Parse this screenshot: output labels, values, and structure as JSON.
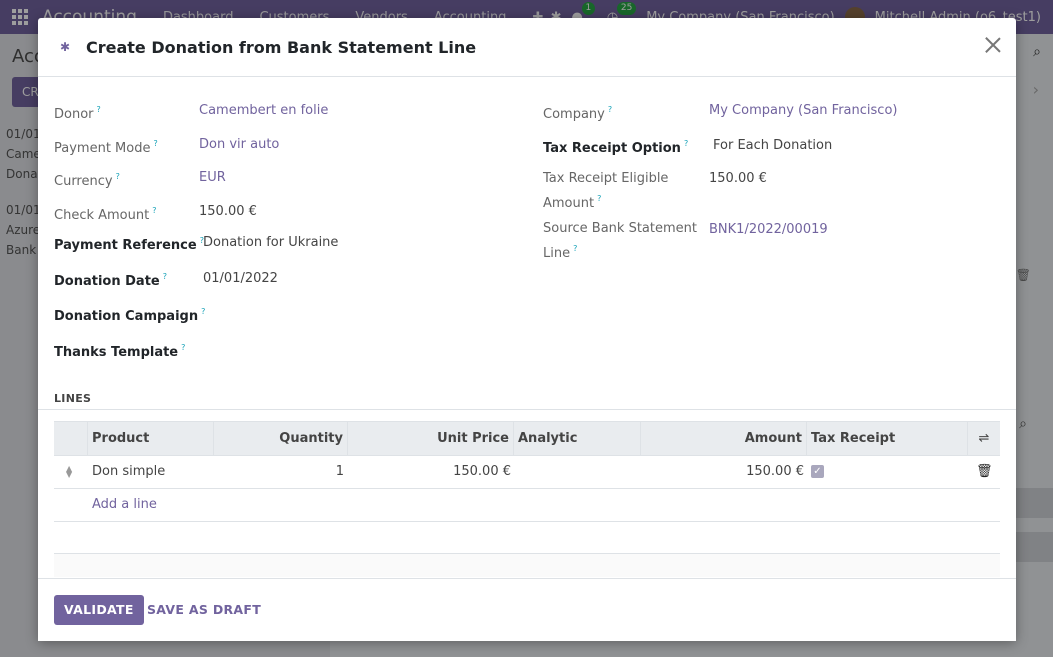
{
  "app": {
    "brand": "Accounting",
    "menu": [
      "Dashboard",
      "Customers",
      "Vendors",
      "Accounting"
    ],
    "chat_count": "1",
    "activity_count": "25",
    "company": "My Company (San Francisco)",
    "user": "Mitchell Admin (o6_test1)",
    "breadcrumb": "Acc",
    "create_btn": "CR",
    "rows": [
      [
        "01/01",
        "Came",
        "Dona"
      ],
      [
        "01/01",
        "Azure",
        "Bank"
      ]
    ]
  },
  "modal": {
    "title": "Create Donation from Bank Statement Line",
    "left_fields": [
      {
        "label": "Donor",
        "value": "Camembert en folie"
      },
      {
        "label": "Payment Mode",
        "value": "Don vir auto"
      },
      {
        "label": "Currency",
        "value": "EUR"
      },
      {
        "label": "Check Amount",
        "value": "150.00 €"
      },
      {
        "label": "Payment Reference",
        "value": "Donation for Ukraine"
      },
      {
        "label": "Donation Date",
        "value": "01/01/2022"
      },
      {
        "label": "Donation Campaign",
        "value": ""
      },
      {
        "label": "Thanks Template",
        "value": ""
      }
    ],
    "right_fields": [
      {
        "label": "Company",
        "value": "My Company (San Francisco)"
      },
      {
        "label": "Tax Receipt Option",
        "value": "For Each Donation"
      },
      {
        "label_line1": "Tax Receipt Eligible",
        "label_line2": "Amount",
        "value": "150.00 €"
      },
      {
        "label_line1": "Source Bank Statement",
        "label_line2": "Line",
        "value": "BNK1/2022/00019"
      }
    ],
    "help_mark": "?",
    "lines_title": "LINES",
    "table": {
      "headers": [
        "Product",
        "Quantity",
        "Unit Price",
        "Analytic",
        "Amount",
        "Tax Receipt"
      ],
      "rows": [
        {
          "product": "Don simple",
          "quantity": "1",
          "unit_price": "150.00 €",
          "analytic": "",
          "amount": "150.00 €",
          "tax_receipt": true
        }
      ],
      "add_line": "Add a line"
    },
    "buttons": {
      "validate": "VALIDATE",
      "save_draft": "SAVE AS DRAFT"
    }
  },
  "colors": {
    "primary": "#71639e",
    "help": "#17a2b8"
  }
}
